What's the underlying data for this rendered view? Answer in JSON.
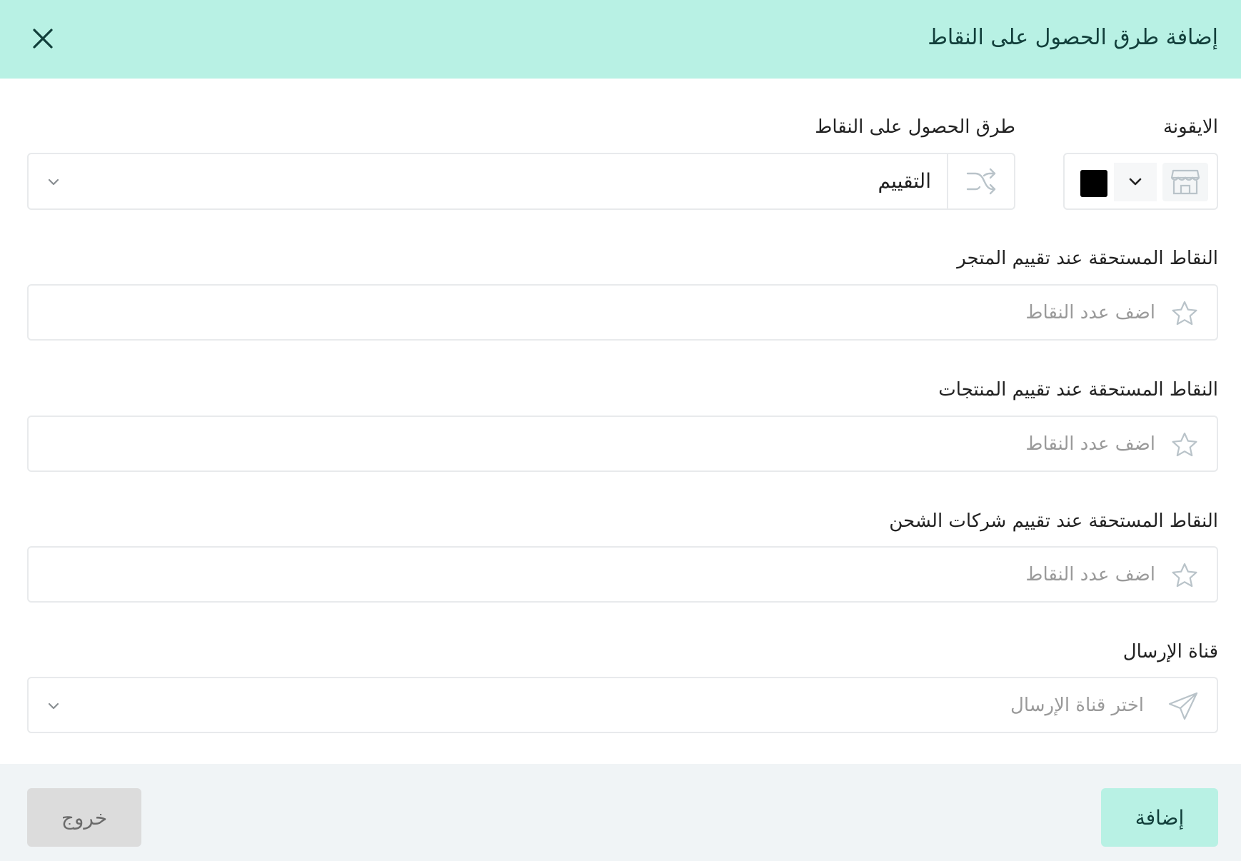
{
  "header": {
    "title": "إضافة طرق الحصول على النقاط"
  },
  "form": {
    "icon_label": "الايقونة",
    "method_label": "طرق الحصول على النقاط",
    "method_value": "التقييم",
    "fields": [
      {
        "label": "النقاط المستحقة عند تقييم المتجر",
        "placeholder": "اضف عدد النقاط",
        "value": ""
      },
      {
        "label": "النقاط المستحقة عند تقييم المنتجات",
        "placeholder": "اضف عدد النقاط",
        "value": ""
      },
      {
        "label": "النقاط المستحقة عند تقييم شركات الشحن",
        "placeholder": "اضف عدد النقاط",
        "value": ""
      }
    ],
    "channel_label": "قناة الإرسال",
    "channel_placeholder": "اختر قناة الإرسال"
  },
  "footer": {
    "add_label": "إضافة",
    "exit_label": "خروج"
  },
  "colors": {
    "header_bg": "#b8f1e4",
    "icon_color": "#000000",
    "footer_bg": "#f0f4f6"
  },
  "icons": [
    "close-icon",
    "store-icon",
    "chevron-down-icon",
    "shuffle-icon",
    "star-icon",
    "paper-plane-icon"
  ]
}
